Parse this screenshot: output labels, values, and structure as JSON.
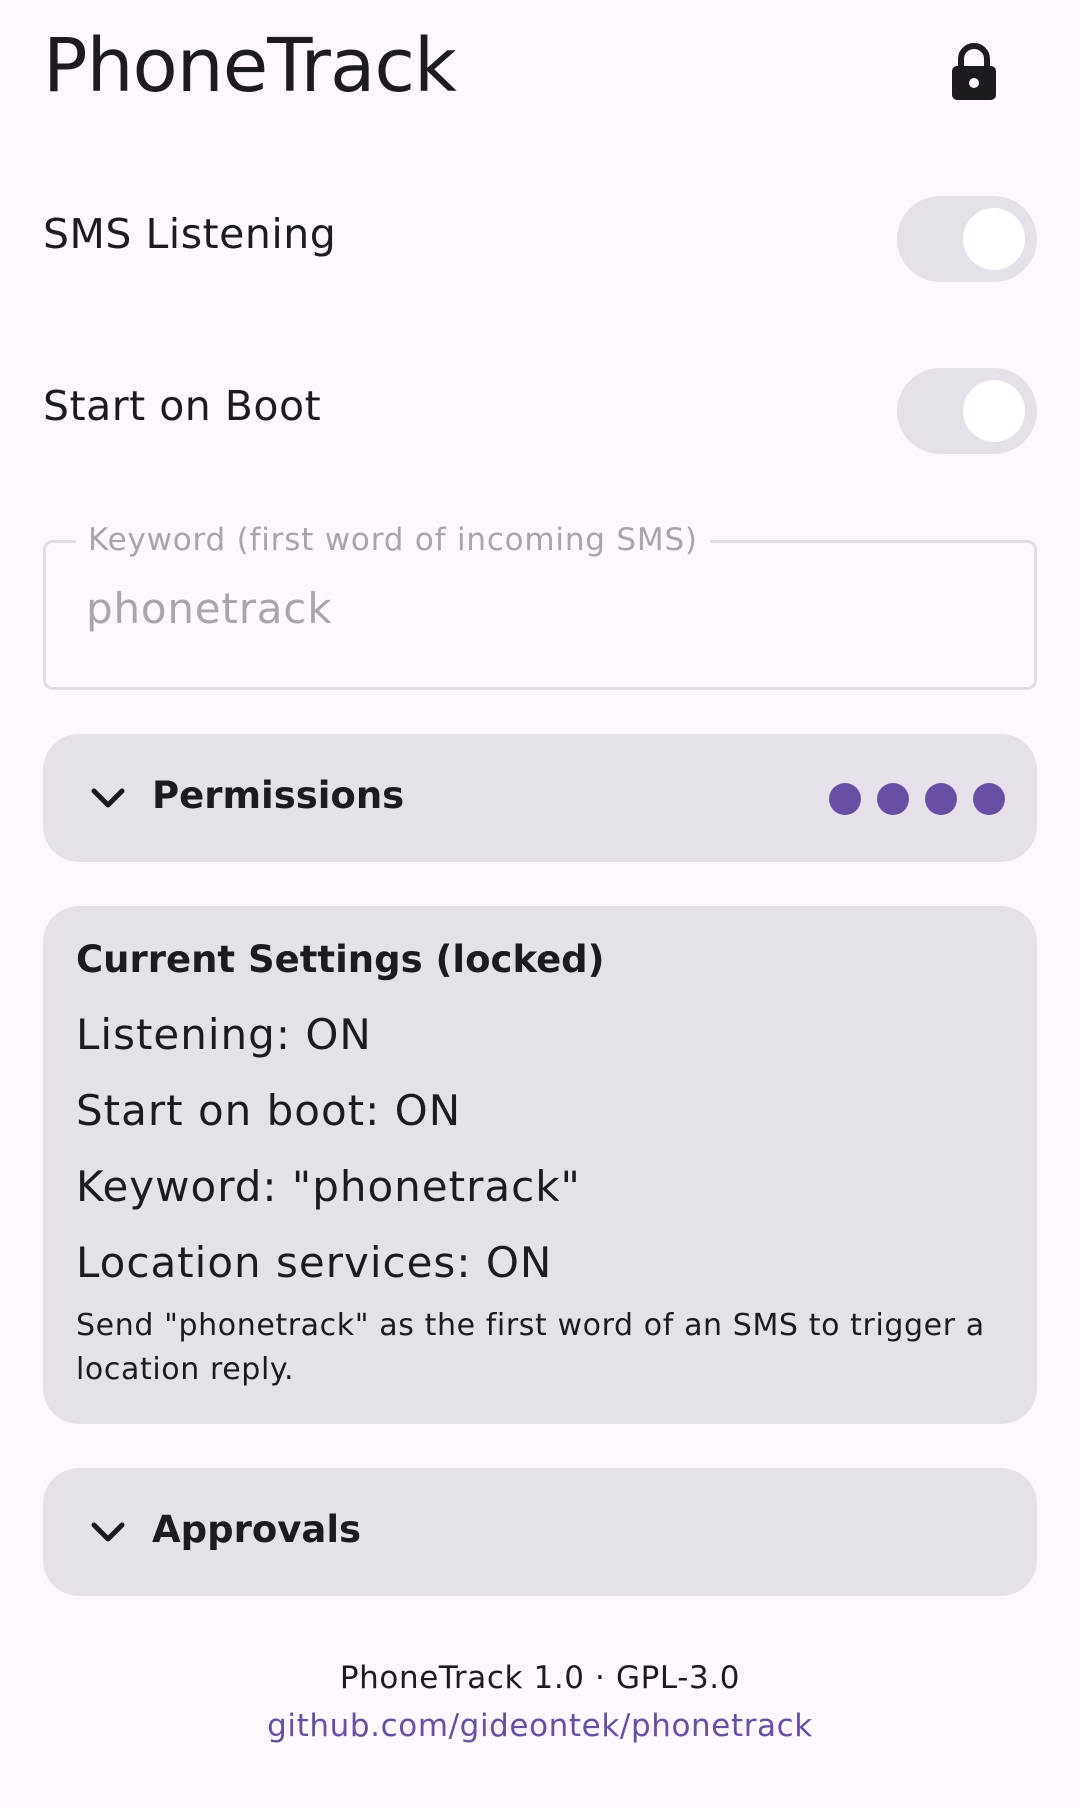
{
  "header": {
    "title": "PhoneTrack",
    "lock_icon": "lock-icon"
  },
  "sms_listening": {
    "label": "SMS Listening",
    "enabled": true
  },
  "start_on_boot": {
    "label": "Start on Boot",
    "enabled": true
  },
  "keyword": {
    "label": "Keyword (first word of incoming SMS)",
    "value": "phonetrack"
  },
  "permissions": {
    "title": "Permissions",
    "expand_icon": "chevron-down-icon",
    "status_dots": 4,
    "dot_color": "#6750a4"
  },
  "current_settings": {
    "title": "Current Settings (locked)",
    "lines": [
      "Listening: ON",
      "Start on boot: ON",
      "Keyword: \"phonetrack\"",
      "Location services: ON"
    ],
    "note": "Send \"phonetrack\" as the first word of an SMS to trigger a location reply."
  },
  "approvals": {
    "title": "Approvals",
    "expand_icon": "chevron-down-icon"
  },
  "footer": {
    "version": "PhoneTrack 1.0 · GPL-3.0",
    "link": "github.com/gideontek/phonetrack"
  },
  "colors": {
    "background": "#fef7ff",
    "surface_variant": "#e6e0e9",
    "primary": "#6750a4",
    "on_surface": "#1d1b20"
  }
}
